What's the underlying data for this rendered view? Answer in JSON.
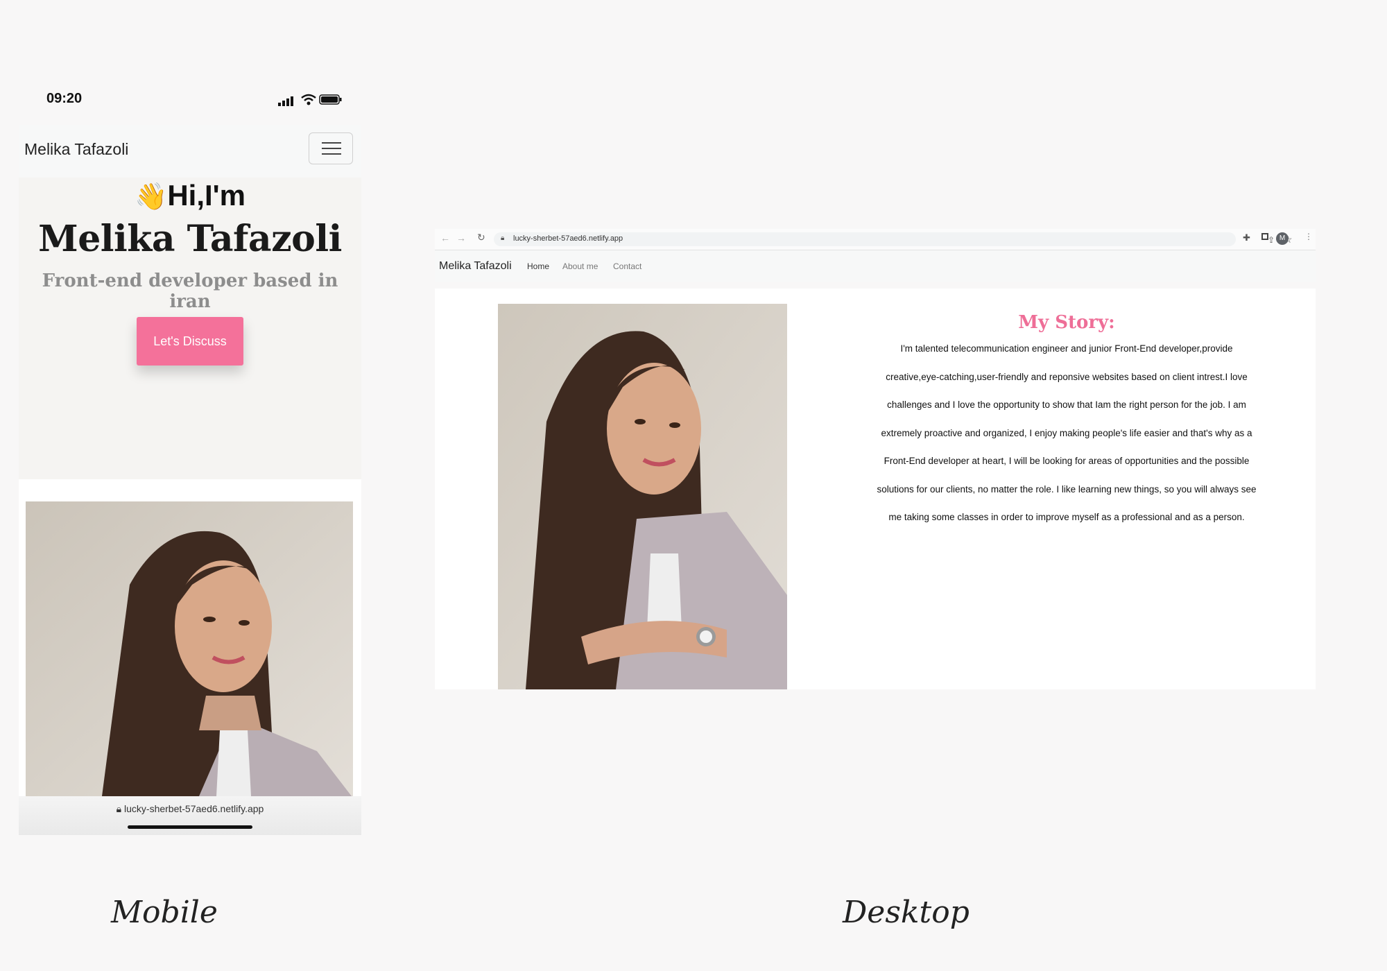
{
  "mobile": {
    "status_bar": {
      "time": "09:20"
    },
    "navbar": {
      "brand": "Melika Tafazoli"
    },
    "hero": {
      "wave_emoji": "👋",
      "greeting": "Hi,I'm",
      "name": "Melika Tafazoli",
      "subtitle": "Front-end developer based in iran",
      "cta_label": "Let's Discuss"
    },
    "url_bar": {
      "url": "lucky-sherbet-57aed6.netlify.app"
    },
    "caption": "Mobile"
  },
  "desktop": {
    "browser": {
      "url": "lucky-sherbet-57aed6.netlify.app",
      "avatar_letter": "M"
    },
    "navbar": {
      "brand": "Melika Tafazoli",
      "links": [
        "Home",
        "About me",
        "Contact"
      ]
    },
    "story": {
      "title": "My Story:",
      "text": "I'm talented telecommunication engineer and junior Front-End developer,provide creative,eye-catching,user-friendly and reponsive websites based on client intrest.I love challenges and I love the opportunity to show that Iam the right person for the job. I am extremely proactive and organized, I enjoy making people's life easier and that's why as a Front-End developer at heart, I will be looking for areas of opportunities and the possible solutions for our clients, no matter the role. I like learning new things, so you will always see me taking some classes in order to improve myself as a professional and as a person."
    },
    "caption": "Desktop"
  },
  "colors": {
    "accent_pink": "#f4719a",
    "title_pink": "#ee6e97",
    "page_bg": "#f8f7f7"
  }
}
